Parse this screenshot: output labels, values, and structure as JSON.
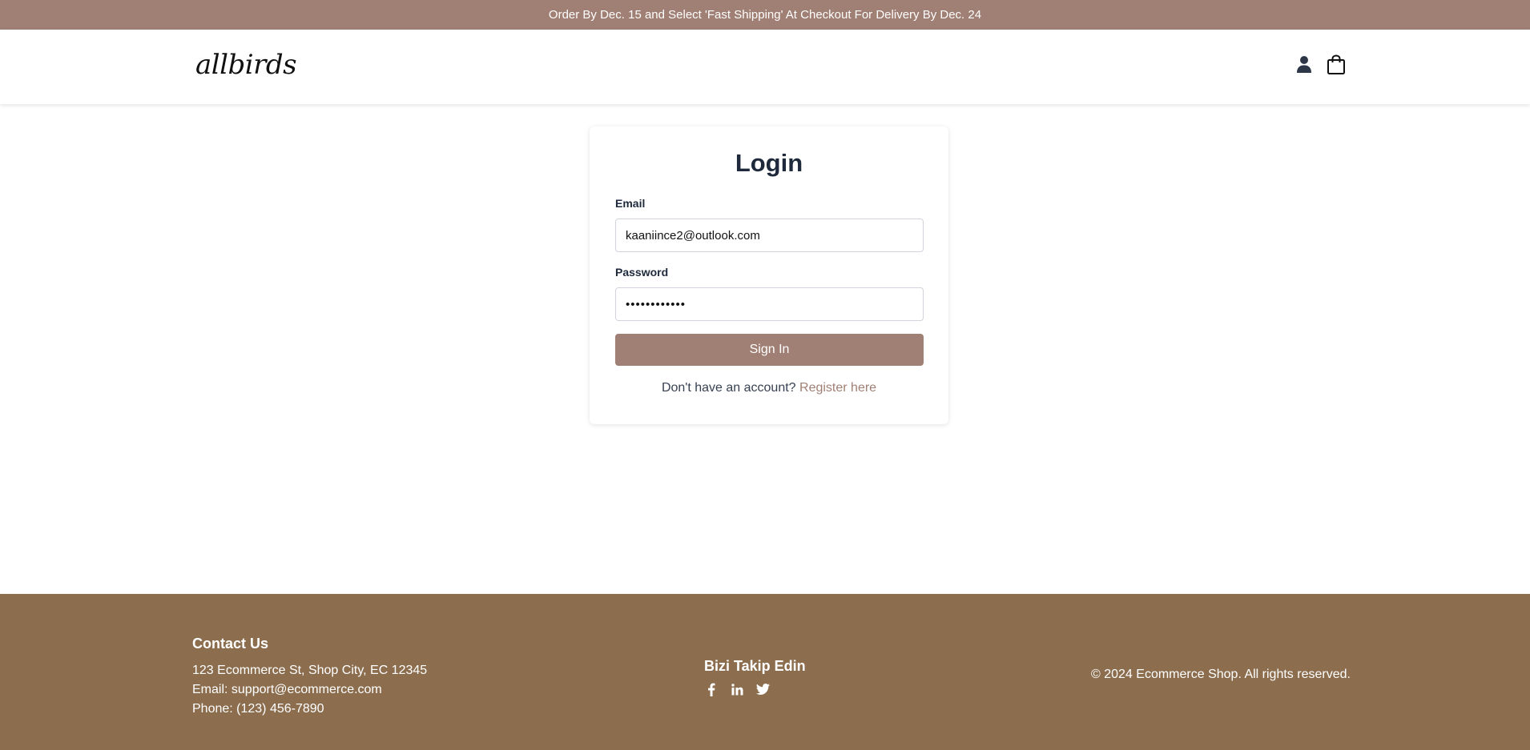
{
  "announcement": "Order By Dec. 15 and Select 'Fast Shipping' At Checkout For Delivery By Dec. 24",
  "header": {
    "logo_text": "allbirds",
    "icons": [
      "user-icon",
      "shopping-bag-icon"
    ]
  },
  "login": {
    "title": "Login",
    "email_label": "Email",
    "email_value": "kaaniince2@outlook.com",
    "password_label": "Password",
    "password_value": "••••••••••••",
    "submit_label": "Sign In",
    "register_prompt": "Don't have an account?",
    "register_link": "Register here"
  },
  "footer": {
    "contact_title": "Contact Us",
    "address": "123 Ecommerce St, Shop City, EC 12345",
    "email": "Email: support@ecommerce.com",
    "phone": "Phone: (123) 456-7890",
    "follow_title": "Bizi Takip Edin",
    "social_icons": [
      "facebook-icon",
      "linkedin-icon",
      "twitter-icon"
    ],
    "copyright": "© 2024 Ecommerce Shop. All rights reserved."
  },
  "colors": {
    "accent": "#a07f74",
    "footer_bg": "#8c6e4f",
    "heading": "#1e2a3b"
  }
}
